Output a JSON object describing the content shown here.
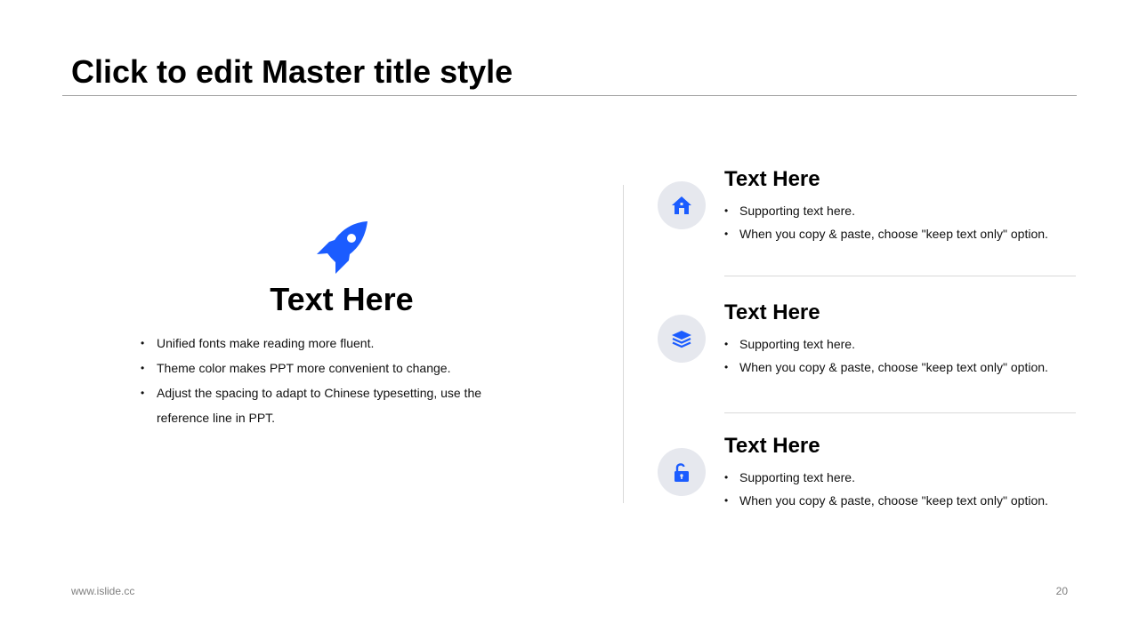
{
  "slide": {
    "title": "Click to edit Master title style",
    "accent_color": "#1b5cff"
  },
  "left_panel": {
    "icon": "rocket-icon",
    "heading": "Text Here",
    "bullets": [
      "Unified fonts make reading more fluent.",
      "Theme color makes PPT more convenient to change.",
      "Adjust the spacing to adapt to Chinese typesetting, use the reference line in PPT."
    ]
  },
  "right_items": [
    {
      "icon": "home-icon",
      "heading": "Text Here",
      "bullets": [
        "Supporting text here.",
        "When you copy & paste, choose \"keep text only\" option."
      ]
    },
    {
      "icon": "layers-icon",
      "heading": "Text Here",
      "bullets": [
        "Supporting text here.",
        "When you copy & paste, choose \"keep text only\" option."
      ]
    },
    {
      "icon": "unlock-icon",
      "heading": "Text Here",
      "bullets": [
        "Supporting text here.",
        "When you copy & paste, choose \"keep text only\" option."
      ]
    }
  ],
  "footer": {
    "url": "www.islide.cc",
    "page_number": "20"
  }
}
